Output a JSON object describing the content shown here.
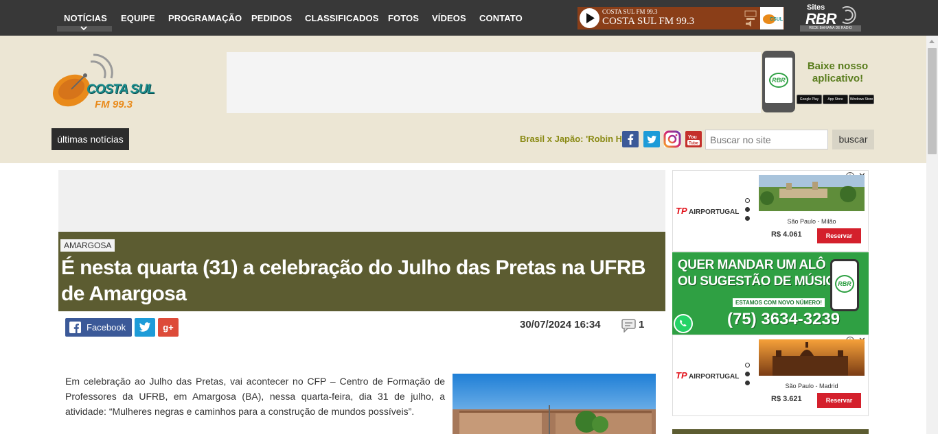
{
  "nav": {
    "items": [
      {
        "label": "NOTÍCIAS",
        "active": true
      },
      {
        "label": "EQUIPE"
      },
      {
        "label": "PROGRAMAÇÃO"
      },
      {
        "label": "PEDIDOS"
      },
      {
        "label": "CLASSIFICADOS"
      },
      {
        "label": "FOTOS"
      },
      {
        "label": "VÍDEOS"
      },
      {
        "label": "CONTATO"
      }
    ],
    "player": {
      "station_small": "COSTA SUL FM 99.3",
      "station": "COSTA SUL FM 99.3",
      "icon": "play-icon"
    },
    "network": {
      "sites_label": "Sites",
      "brand": "RBR",
      "subtitle": "REDE BAHIANA DE RÁDIO"
    }
  },
  "header": {
    "logo": {
      "name": "COSTA SUL",
      "frequency": "FM 99.3"
    },
    "app_promo": {
      "line1": "Baixe nosso",
      "line2": "aplicativo!",
      "phone_brand": "RBR",
      "stores": [
        "Google Play",
        "App Store",
        "Windows Store"
      ]
    },
    "latest_news_label": "últimas notícias",
    "ticker_text": "Brasil x Japão: 'Robin Hood'",
    "search": {
      "placeholder": "Buscar no site",
      "button": "buscar"
    },
    "social": [
      "facebook-icon",
      "twitter-icon",
      "instagram-icon",
      "youtube-icon"
    ]
  },
  "article": {
    "category": "AMARGOSA",
    "title": "É nesta quarta (31) a celebração do Julho das Pretas na UFRB de Amargosa",
    "share": {
      "facebook": "Facebook",
      "googleplus": "g+"
    },
    "date": "30/07/2024 16:34",
    "comments": "1",
    "body": "Em celebração ao Julho das Pretas, vai acontecer no CFP – Centro de Formação de Professores da UFRB, em Amargosa (BA), nessa quarta-feira, dia 31 de julho, a atividade: “Mulheres negras e caminhos para a construção de mundos possíveis”."
  },
  "sidebar": {
    "ads": [
      {
        "airline": "AIRPORTUGAL",
        "airline_prefix": "TP",
        "route": "São Paulo - Milão",
        "price": "R$ 4.061",
        "cta": "Reservar"
      },
      {
        "airline": "AIRPORTUGAL",
        "airline_prefix": "TP",
        "route": "São Paulo - Madrid",
        "price": "R$ 3.621",
        "cta": "Reservar"
      }
    ],
    "promo": {
      "line1": "QUER MANDAR UM ALÔ",
      "line2": "OU SUGESTÃO DE MÚSICA?",
      "badge": "ESTAMOS COM NOVO NÚMERO!",
      "phone": "(75) 3634-3239",
      "brand": "RBR"
    }
  },
  "colors": {
    "nav_bg": "#383838",
    "header_bg": "#ece6d4",
    "headline_bg": "#5c5c31",
    "accent_green": "#5a7d1e",
    "promo_green": "#2fa043"
  }
}
